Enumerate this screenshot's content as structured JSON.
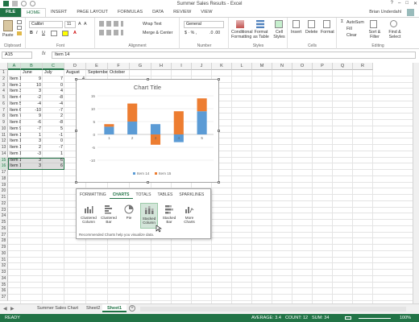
{
  "window": {
    "title": "Summer Sales Results - Excel",
    "user": "Brian Underdahl",
    "controls": [
      "?",
      "–",
      "□",
      "✕"
    ]
  },
  "tabs": [
    "FILE",
    "HOME",
    "INSERT",
    "PAGE LAYOUT",
    "FORMULAS",
    "DATA",
    "REVIEW",
    "VIEW"
  ],
  "ribbon": {
    "paste": "Paste",
    "font_name": "Calibri",
    "font_size": "11",
    "wrap_text": "Wrap Text",
    "merge_center": "Merge & Center",
    "number_format": "General",
    "conditional_formatting": "Conditional Formatting",
    "format_as_table": "Format as Table",
    "cell_styles": "Cell Styles",
    "insert": "Insert",
    "delete": "Delete",
    "format": "Format",
    "autosum": "AutoSum",
    "fill": "Fill",
    "clear": "Clear",
    "sort_filter": "Sort & Filter",
    "find_select": "Find & Select",
    "groups": [
      "Clipboard",
      "Font",
      "Alignment",
      "Number",
      "Styles",
      "Cells",
      "Editing"
    ]
  },
  "formula_bar": {
    "name_box": "A15",
    "fx": "fx",
    "value": "Item 14"
  },
  "columns": [
    "A",
    "B",
    "C",
    "D",
    "E",
    "F",
    "G",
    "H",
    "I",
    "J",
    "K",
    "L",
    "M",
    "N",
    "O",
    "P",
    "Q",
    "R"
  ],
  "headers": [
    "June",
    "July",
    "August",
    "September",
    "October"
  ],
  "rows": [
    [
      "Item 1",
      "9",
      "7",
      "4",
      "",
      ""
    ],
    [
      "Item 2",
      "10",
      "0",
      "",
      "",
      ""
    ],
    [
      "Item 3",
      "3",
      "4",
      "",
      "",
      ""
    ],
    [
      "Item 4",
      "-2",
      "-8",
      "",
      "",
      ""
    ],
    [
      "Item 5",
      "-4",
      "-4",
      "",
      "",
      ""
    ],
    [
      "Item 6",
      "-10",
      "-7",
      "",
      "",
      ""
    ],
    [
      "Item 7",
      "9",
      "2",
      "",
      "",
      ""
    ],
    [
      "Item 8",
      "-6",
      "-8",
      "",
      "",
      ""
    ],
    [
      "Item 9",
      "-7",
      "5",
      "",
      "",
      ""
    ],
    [
      "Item 10",
      "1",
      "-1",
      "",
      "",
      ""
    ],
    [
      "Item 11",
      "3",
      "0",
      "",
      "",
      ""
    ],
    [
      "Item 12",
      "2",
      "-7",
      "",
      "",
      ""
    ],
    [
      "Item 13",
      "-3",
      "1",
      "",
      "",
      ""
    ],
    [
      "Item 14",
      "3",
      "6",
      "",
      "",
      ""
    ],
    [
      "Item 15",
      "3",
      "6",
      "",
      "",
      ""
    ]
  ],
  "chart_data": {
    "type": "bar",
    "stacked": true,
    "title": "Chart Title",
    "categories": [
      "1",
      "2",
      "3",
      "4",
      "5"
    ],
    "series": [
      {
        "name": "Item 14",
        "color": "#5b9bd5",
        "values": [
          3,
          5,
          4,
          -3,
          9
        ]
      },
      {
        "name": "Item 15",
        "color": "#ed7d31",
        "values": [
          1,
          7,
          -4,
          9,
          5
        ]
      }
    ],
    "ylim": [
      -10,
      15
    ],
    "yticks": [
      "15",
      "10",
      "5",
      "0",
      "-5",
      "-10"
    ],
    "legend": "bottom"
  },
  "quick_analysis": {
    "tabs": [
      "FORMATTING",
      "CHARTS",
      "TOTALS",
      "TABLES",
      "SPARKLINES"
    ],
    "active_tab": "CHARTS",
    "items": [
      "Clustered Column",
      "Clustered Bar",
      "Pie",
      "Stacked Column",
      "Stacked Bar",
      "More Charts"
    ],
    "active_item": "Stacked Column",
    "note": "Recommended Charts help you visualize data."
  },
  "sheets": [
    "Summer Sales Chart",
    "Sheet2",
    "Sheet1"
  ],
  "active_sheet": "Sheet1",
  "status": {
    "ready": "READY",
    "average": "AVERAGE: 3.4",
    "count": "COUNT: 12",
    "sum": "SUM: 34",
    "zoom": "100%"
  },
  "colors": {
    "accent": "#217346",
    "series1": "#5b9bd5",
    "series2": "#ed7d31"
  }
}
